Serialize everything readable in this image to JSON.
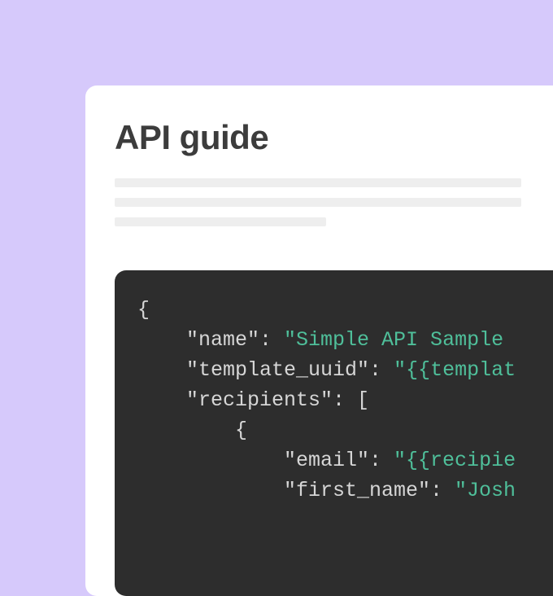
{
  "doc": {
    "title": "API guide"
  },
  "code": {
    "open_brace": "{",
    "k_name": "\"name\"",
    "v_name": "\"Simple API Sample ",
    "k_template": "\"template_uuid\"",
    "v_template": "\"{{templat",
    "k_recipients": "\"recipients\"",
    "arr_open": "[",
    "inner_open": "{",
    "k_email": "\"email\"",
    "v_email": "\"{{recipie",
    "k_first_name": "\"first_name\"",
    "v_first_name": "\"Josh",
    "colon": ":",
    "comma": ",",
    "colon_sp": ": "
  }
}
